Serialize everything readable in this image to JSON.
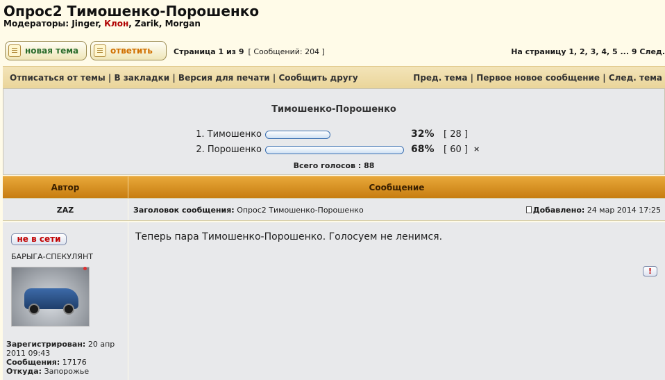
{
  "topic": {
    "title": "Опрос2 Тимошенко-Порошенко"
  },
  "moderators": {
    "label": "Модераторы:",
    "names": [
      "Jinger",
      "Клон",
      "Zarik",
      "Morgan"
    ]
  },
  "buttons": {
    "new_topic": "новая тема",
    "reply": "ответить",
    "new_topic_icon": "document-icon",
    "reply_icon": "document-icon"
  },
  "pagination": {
    "page_label": "Страница 1 из 9",
    "posts_count": "[ Сообщений: 204 ]",
    "goto_label": "На страницу",
    "pages": "1, 2, 3, 4, 5 ... 9",
    "next": "След."
  },
  "nav": {
    "left": [
      "Отписаться от темы",
      "В закладки",
      "Версия для печати",
      "Сообщить другу"
    ],
    "right": [
      "Пред. тема",
      "Первое новое сообщение",
      "След. тема"
    ]
  },
  "poll": {
    "title": "Тимошенко-Порошенко",
    "options": [
      {
        "label": "1. Тимошенко",
        "percent_text": "32%",
        "percent": 32,
        "votes_text": "[ 28 ]"
      },
      {
        "label": "2. Порошенко",
        "percent_text": "68%",
        "percent": 68,
        "votes_text": "[ 60 ]"
      }
    ],
    "voted_mark": "×",
    "total": "Всего голосов : 88"
  },
  "table": {
    "author_header": "Автор",
    "message_header": "Сообщение"
  },
  "post": {
    "author": "ZAZ",
    "subject_label": "Заголовок сообщения:",
    "subject": "Опрос2 Тимошенко-Порошенко",
    "date_label": "Добавлено:",
    "date": "24 мар 2014 17:25",
    "status": "не в сети",
    "rank": "БАРЫГА-СПЕКУЛЯНТ",
    "registered_label": "Зарегистрирован:",
    "registered": "20 апр 2011 09:43",
    "posts_label": "Сообщения:",
    "posts": "17176",
    "from_label": "Откуда:",
    "from": "Запорожье",
    "text": "Теперь пара Тимошенко-Порошенко. Голосуем не ленимся.",
    "report": "!",
    "colors": {
      "status_text": "#c00000",
      "moderator_highlight": "#b00000"
    }
  }
}
